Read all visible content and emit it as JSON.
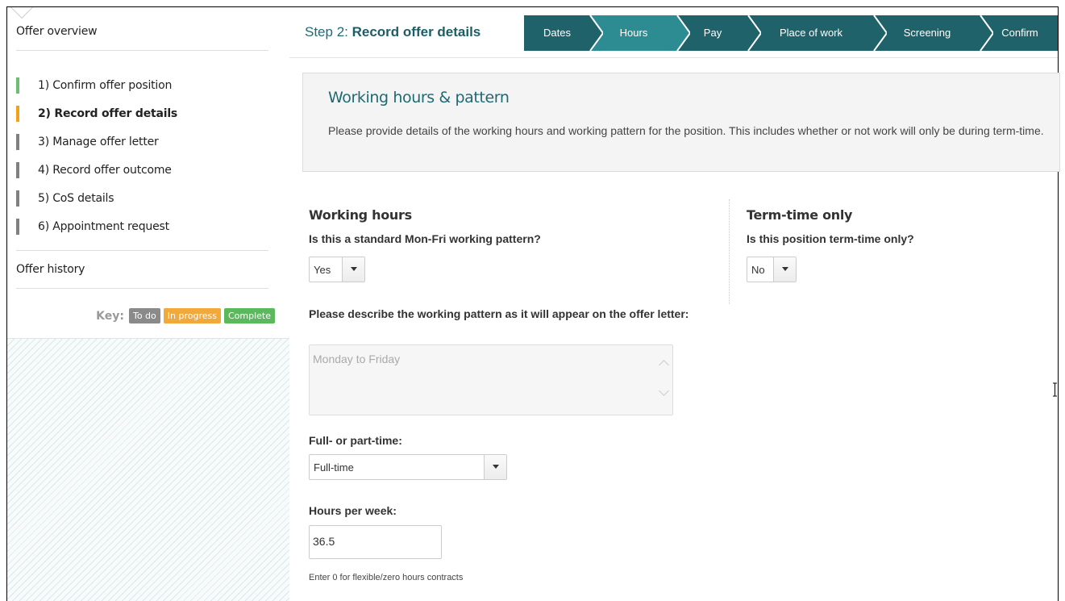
{
  "sidebar": {
    "title": "Offer overview",
    "steps": [
      {
        "label": "1) Confirm offer position",
        "status": "complete",
        "color": "#6cbf70"
      },
      {
        "label": "2) Record offer details",
        "status": "in-progress",
        "color": "#f0a21f"
      },
      {
        "label": "3) Manage offer letter",
        "status": "to-do",
        "color": "#808080"
      },
      {
        "label": "4) Record offer outcome",
        "status": "to-do",
        "color": "#808080"
      },
      {
        "label": "5) CoS details",
        "status": "to-do",
        "color": "#808080"
      },
      {
        "label": "6) Appointment request",
        "status": "to-do",
        "color": "#808080"
      }
    ],
    "history_label": "Offer history",
    "key": {
      "label": "Key:",
      "todo": "To do",
      "in_progress": "In progress",
      "complete": "Complete",
      "colors": {
        "todo": "#8a8a8a",
        "in_progress": "#f2a93b",
        "complete": "#5cb85c"
      }
    }
  },
  "header": {
    "step_prefix": "Step 2: ",
    "step_title": "Record offer details",
    "wizard": [
      {
        "label": "Dates",
        "active": false
      },
      {
        "label": "Hours",
        "active": true
      },
      {
        "label": "Pay",
        "active": false
      },
      {
        "label": "Place of work",
        "active": false
      },
      {
        "label": "Screening",
        "active": false
      },
      {
        "label": "Confirm",
        "active": false
      }
    ],
    "colors": {
      "wizard_bg": "#1f6269",
      "wizard_active": "#2c8c92"
    }
  },
  "intro": {
    "title": "Working hours & pattern",
    "text": "Please provide details of the working hours and working pattern for the position. This includes whether or not work will only be during term-time."
  },
  "working_hours": {
    "title": "Working hours",
    "standard_question": "Is this a standard Mon-Fri working pattern?",
    "standard_value": "Yes",
    "pattern_question": "Please describe the working pattern as it will appear on the offer letter:",
    "pattern_value": "Monday to Friday",
    "fulltime_question": "Full- or part-time:",
    "fulltime_value": "Full-time",
    "hours_question": "Hours per week:",
    "hours_value": "36.5",
    "hours_hint": "Enter 0 for flexible/zero hours contracts"
  },
  "term_time": {
    "title": "Term-time only",
    "question": "Is this position term-time only?",
    "value": "No"
  }
}
